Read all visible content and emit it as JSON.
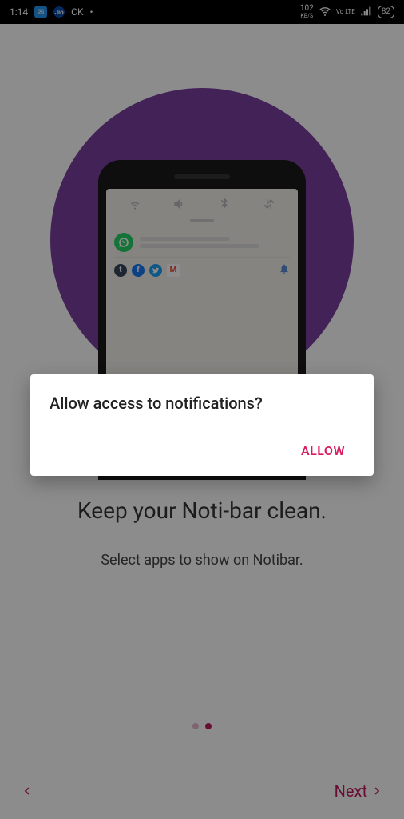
{
  "status": {
    "time": "1:14",
    "ck_label": "CK",
    "speed": "102",
    "speed_unit": "KB/S",
    "volte": "Vo LTE",
    "battery": "82"
  },
  "onboarding": {
    "headline": "Keep your Noti-bar clean.",
    "subline": "Select apps to show on Notibar.",
    "next_label": "Next"
  },
  "dialog": {
    "title": "Allow access to notifications?",
    "allow_label": "ALLOW"
  },
  "phone_mock": {
    "gmail_letter": "M",
    "fb_letter": "f",
    "tumblr_letter": "t"
  }
}
